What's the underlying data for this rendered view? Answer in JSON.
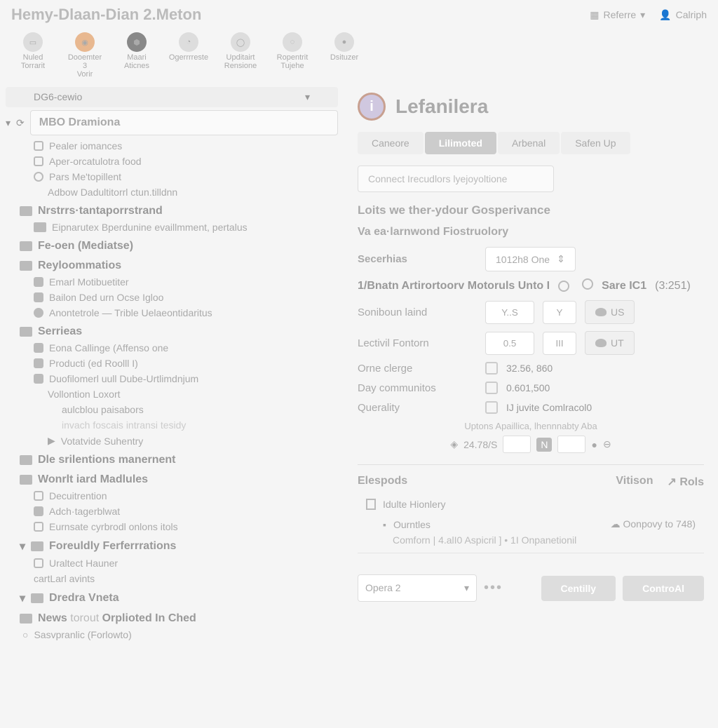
{
  "app_title": "Hemy-Dlaan-Dian 2.Meton",
  "topbar": {
    "referre": "Referre",
    "user": "Calriph"
  },
  "toolbar": [
    {
      "label1": "Nuled",
      "label2": "Torrarit"
    },
    {
      "label1": "Dooemter 3",
      "label2": "Vorir"
    },
    {
      "label1": "Maari",
      "label2": "Aticnes"
    },
    {
      "label1": "Ogerrrreste",
      "label2": ""
    },
    {
      "label1": "Upditairt",
      "label2": "Rensione"
    },
    {
      "label1": "Ropentrit",
      "label2": "Tujehe"
    },
    {
      "label1": "Dsituzer",
      "label2": ""
    }
  ],
  "side": {
    "header_left": "DG6-cewio",
    "search_value": "MBO Dramiona",
    "tree": {
      "g1_1": "Pealer iomances",
      "g1_2": "Aper-orcatulotra food",
      "g1_3": "Pars Me'topillent",
      "g1_4": "Adbow Dadultitorrl ctun.tilldnn",
      "g2": "Nrstrrs·tantaporrstrand",
      "g2_1": "Eipnarutex Bperdunine evaillmment, pertalus",
      "g3": "Fe-oen (Mediatse)",
      "g4": "Reyloommatios",
      "g4_1": "Emarl Motibuetiter",
      "g4_2": "Bailon Ded urn Ocse Igloo",
      "g4_3": "Anontetrole — Trible Uelaeontidaritus",
      "g5": "Serrieas",
      "g5_1": "Eona Callinge (Affenso one",
      "g5_2": "Producti (ed Roolll I)",
      "g5_3": "Duofilomerl uull Dube-Urtlimdnjum",
      "g5_4": "Vollontion Loxort",
      "g5_5": "aulcblou paisabors",
      "g5_6": "invach foscais intransi tesidy",
      "g5_7": "Votatvide Suhentry",
      "g6": "Dle srilentions manernent",
      "g7": "Wonrlt iard Madlules",
      "g7_1": "Decuitrention",
      "g7_2": "Adch·tagerblwat",
      "g7_3": "Eurnsate cyrbrodl onlons itols",
      "g8": "Foreuldly Ferferrrations",
      "g8_1": "Uraltect Hauner",
      "g8_2": "cartLarl avints",
      "g9": "Dredra Vneta",
      "g10_a": "News ",
      "g10_b": "Orplioted In Ched",
      "g11": "Sasvpranlic (Forlowto)"
    }
  },
  "content": {
    "title": "Lefanilera",
    "tabs": [
      "Caneore",
      "Lilimoted",
      "Arbenal",
      "Safen Up"
    ],
    "search_ph": "Connect Irecudlors lyejoyoltione",
    "sec1": "Loits we ther-ydour Gosperivance",
    "sec2": "Va ea·larnwond Fiostruolory",
    "secerhias": "Secerhias",
    "secerhias_val": "1012h8 One",
    "radios_label": "1/Bnatn Artirortoorv Motoruls Unto I",
    "radios_r2": "Sare IC1",
    "radios_r2_n": "(3:251)",
    "row1": "Soniboun laind",
    "row1_v1": "Y..S",
    "row1_v2": "Y",
    "row1_u": "US",
    "row2": "Lectivil Fontorn",
    "row2_v1": "0.5",
    "row2_v2": "III",
    "row2_u": "UT",
    "row3": "Orne clerge",
    "row3_v": "32.56, 860",
    "row4": "Day communitos",
    "row4_v": "0.601,500",
    "row5": "Querality",
    "row5_v": "IJ juvite Comlracol0",
    "note": "Uptons Apaillica, lhennnabty Aba",
    "mini": "24.78/S",
    "hr1": "Elespods",
    "hr2": "Vitison",
    "hr3": "Rols",
    "file1": "Idulte Hionlery",
    "file2": "Ourntles",
    "file2_date": "Oonpovy to 748)",
    "desc": "Comforn | 4.alI0 Aspicril ] • 1I Onpanetionil",
    "footer_sel": "Opera 2",
    "btn1": "Centilly",
    "btn2": "ControAl"
  }
}
